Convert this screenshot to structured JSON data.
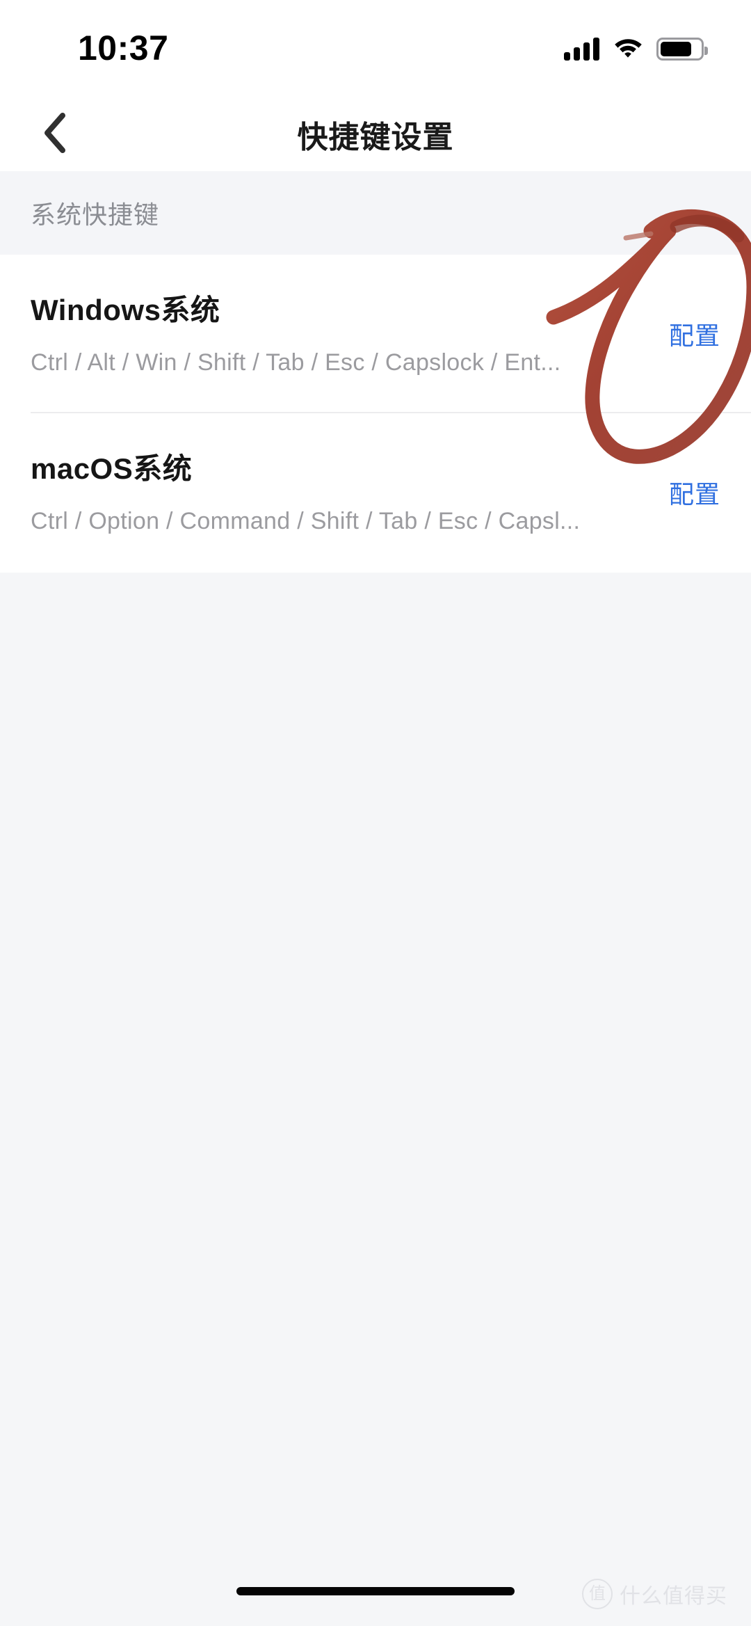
{
  "status_bar": {
    "time": "10:37",
    "signal_icon": "cellular-signal-icon",
    "wifi_icon": "wifi-icon",
    "battery_icon": "battery-icon",
    "battery_level_percent": 72
  },
  "nav": {
    "back_icon": "chevron-left-icon",
    "title": "快捷键设置"
  },
  "section": {
    "label": "系统快捷键"
  },
  "list": {
    "rows": [
      {
        "title": "Windows系统",
        "subtitle": "Ctrl / Alt / Win / Shift / Tab / Esc / Capslock / Ent...",
        "action_label": "配置"
      },
      {
        "title": "macOS系统",
        "subtitle": "Ctrl / Option / Command / Shift / Tab / Esc / Capsl...",
        "action_label": "配置"
      }
    ]
  },
  "annotation": {
    "kind": "handwritten-circle-mark",
    "color": "#a8402f"
  },
  "watermark": {
    "mark": "值",
    "text": "什么值得买"
  },
  "colors": {
    "accent_link": "#2f6fe0",
    "page_background": "#f5f6f8",
    "card_background": "#ffffff",
    "section_background": "#f4f5f8",
    "title_text": "#161616",
    "subtitle_text": "#9b9b9f",
    "annotation_red": "#a8402f"
  }
}
